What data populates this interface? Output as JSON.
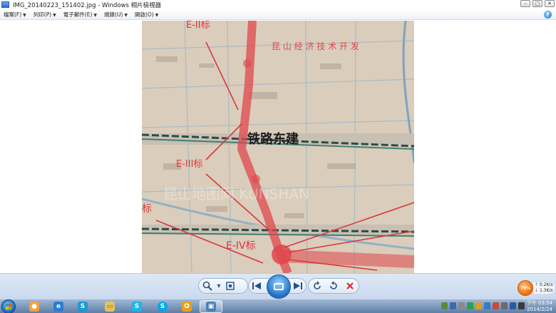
{
  "window": {
    "title": "IMG_20140223_151402.jpg - Windows 相片檢視器",
    "buttons": {
      "minimize": "–",
      "maximize": "□",
      "close": "✕"
    }
  },
  "menu": {
    "items": [
      {
        "label": "檔案(F)"
      },
      {
        "label": "列印(P)"
      },
      {
        "label": "電子郵件(E)"
      },
      {
        "label": "燒錄(U)"
      },
      {
        "label": "開啟(O)"
      }
    ],
    "help_icon": "help-icon"
  },
  "photo": {
    "labels": {
      "zone": "昆 山 经 济 技 术 开 发",
      "railway": "铁路东建",
      "e2": "E-II标",
      "e3": "E-III标",
      "e4": "E-IV标",
      "e1": "标",
      "wm": "昆山地图网  KUNSHAN"
    }
  },
  "controls": {
    "zoom_icon": "magnifier-icon",
    "fit_icon": "actual-size-icon",
    "prev_icon": "previous-icon",
    "slideshow_icon": "slideshow-icon",
    "next_icon": "next-icon",
    "rotate_ccw_icon": "rotate-counterclockwise-icon",
    "rotate_cw_icon": "rotate-clockwise-icon",
    "delete_icon": "delete-icon"
  },
  "network": {
    "percent": "78%",
    "up": "0.2K/s",
    "down": "1.3K/s"
  },
  "taskbar": {
    "time": "下午 03:54",
    "date": "2014/2/24",
    "apps": [
      "game-app",
      "internet-explorer",
      "sogou-browser",
      "file-explorer",
      "sogou-input",
      "skype",
      "outlook",
      "photo-viewer"
    ]
  },
  "colors": {
    "route_red": "#e0474c",
    "rail_dark": "#2f4a45",
    "map_bg": "#d9cbb9",
    "accent_blue": "#1f6fc4"
  }
}
